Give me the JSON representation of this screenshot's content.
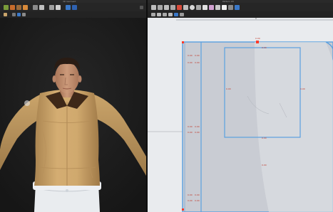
{
  "app": {
    "left_panel_title": "3D Garment",
    "right_panel_title": "Pattern 2D"
  },
  "toolbar3d": {
    "icons": [
      "select-icon",
      "move-icon",
      "simulate-icon",
      "fold-icon",
      "pin-icon",
      "brush-icon",
      "measure-icon",
      "sun-icon",
      "camera-icon",
      "ruler-icon",
      "grid-icon"
    ],
    "row2_icons": [
      "garment-icon",
      "avatar-icon",
      "view-icon",
      "texture-icon"
    ]
  },
  "toolbar2d": {
    "icons": [
      "transform-icon",
      "edit-point-icon",
      "edit-curve-icon",
      "add-point-icon",
      "pen-icon",
      "rectangle-icon",
      "circle-icon",
      "internal-line-icon",
      "dart-icon",
      "pleat-icon",
      "seam-icon",
      "sewing-icon",
      "pin-2d-icon",
      "fold-2d-icon"
    ],
    "row2_icons": [
      "segment-icon",
      "trace-icon",
      "notch-icon",
      "button-icon",
      "grain-icon",
      "annotation-icon"
    ]
  },
  "pattern": {
    "top_width_label": "0.00",
    "upper_width_label": "0.00",
    "inner_width_label": "0.00",
    "left_side_label": "0.00",
    "right_side_label": "0.00",
    "bottom_width_label": "0.00",
    "row_labels_a": [
      "0.00",
      "0.00",
      "0.00",
      "0.00",
      "0.00",
      "0.00"
    ],
    "row_labels_b": [
      "0.00",
      "0.00",
      "0.00",
      "0.00",
      "0.00",
      "0.00"
    ],
    "ruler_label": "0"
  },
  "colors": {
    "shirt": "#c9a46b",
    "collar": "#4a2e1c",
    "pants": "#e9ecef",
    "skin": "#c89677",
    "hair": "#2a1c14",
    "pattern_fill": "#c9ccd3",
    "pattern_line": "#5aa0e0",
    "viewport2d_bg": "#e9ebee"
  }
}
